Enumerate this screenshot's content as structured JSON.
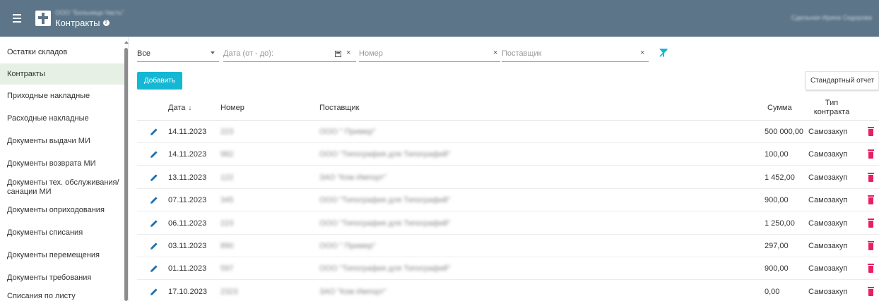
{
  "header": {
    "org_name": "ООО \"Больница Часть\"",
    "title": "Контракты",
    "user_name": "Сдельная Ирина Сидорова"
  },
  "sidebar": {
    "items": [
      {
        "label": "Остатки складов",
        "active": false
      },
      {
        "label": "Контракты",
        "active": true
      },
      {
        "label": "Приходные накладные",
        "active": false
      },
      {
        "label": "Расходные накладные",
        "active": false
      },
      {
        "label": "Документы выдачи МИ",
        "active": false
      },
      {
        "label": "Документы возврата МИ",
        "active": false
      },
      {
        "label": "Документы тех. обслуживания/санации МИ",
        "active": false
      },
      {
        "label": "Документы оприходования",
        "active": false
      },
      {
        "label": "Документы списания",
        "active": false
      },
      {
        "label": "Документы перемещения",
        "active": false
      },
      {
        "label": "Документы требования",
        "active": false
      },
      {
        "label": "Списания по листу",
        "active": false
      }
    ]
  },
  "filters": {
    "type_value": "Все",
    "date_placeholder": "Дата (от - до):",
    "number_placeholder": "Номер",
    "supplier_placeholder": "Поставщик"
  },
  "toolbar": {
    "add_label": "Добавить",
    "report_label": "Стандартный отчет"
  },
  "table": {
    "columns": {
      "date": "Дата",
      "number": "Номер",
      "supplier": "Поставщик",
      "sum": "Сумма",
      "type_line1": "Тип",
      "type_line2": "контракта"
    },
    "rows": [
      {
        "date": "14.11.2023",
        "number": "223",
        "supplier": "ООО \" Пример\"",
        "sum": "500 000,00",
        "type": "Самозакуп"
      },
      {
        "date": "14.11.2023",
        "number": "982",
        "supplier": "ООО \"Типография для Типографий\"",
        "sum": "100,00",
        "type": "Самозакуп"
      },
      {
        "date": "13.11.2023",
        "number": "122",
        "supplier": "ЗАО \"Ком Импорт\"",
        "sum": "1 452,00",
        "type": "Самозакуп"
      },
      {
        "date": "07.11.2023",
        "number": "345",
        "supplier": "ООО \"Типография для Типографий\"",
        "sum": "900,00",
        "type": "Самозакуп"
      },
      {
        "date": "06.11.2023",
        "number": "223",
        "supplier": "ООО \"Типография для Типографий\"",
        "sum": "1 250,00",
        "type": "Самозакуп"
      },
      {
        "date": "03.11.2023",
        "number": "890",
        "supplier": "ООО \" Пример\"",
        "sum": "297,00",
        "type": "Самозакуп"
      },
      {
        "date": "01.11.2023",
        "number": "597",
        "supplier": "ООО \"Типография для Типографий\"",
        "sum": "900,00",
        "type": "Самозакуп"
      },
      {
        "date": "17.10.2023",
        "number": "2323",
        "supplier": "ЗАО \"Ком Импорт\"",
        "sum": "0,00",
        "type": "Самозакуп"
      }
    ]
  },
  "colors": {
    "header_bg": "#5c7588",
    "accent": "#14b8d4",
    "delete": "#e91e63",
    "edit": "#1a6fb0",
    "active_item_bg": "#e7f0e4"
  }
}
